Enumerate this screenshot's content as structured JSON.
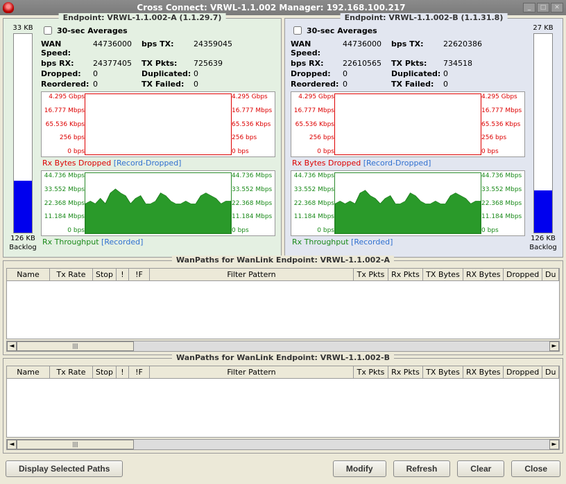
{
  "window": {
    "title": "Cross Connect: VRWL-1.1.002  Manager: 192.168.100.217"
  },
  "endpointA": {
    "title": "Endpoint: VRWL-1.1.002-A  (1.1.29.7)",
    "gauge_top": "33 KB",
    "gauge_bottom_val": "126 KB",
    "gauge_bottom_lbl": "Backlog",
    "gauge_fill_pct": 26,
    "avg_label": "30-sec Averages",
    "stats": {
      "wan_speed_lbl": "WAN Speed:",
      "wan_speed": "44736000",
      "bps_tx_lbl": "bps TX:",
      "bps_tx": "24359045",
      "bps_rx_lbl": "bps RX:",
      "bps_rx": "24377405",
      "tx_pkts_lbl": "TX Pkts:",
      "tx_pkts": "725639",
      "dropped_lbl": "Dropped:",
      "dropped": "0",
      "duplicated_lbl": "Duplicated:",
      "duplicated": "0",
      "reordered_lbl": "Reordered:",
      "reordered": "0",
      "tx_failed_lbl": "TX Failed:",
      "tx_failed": "0"
    },
    "red_chart": {
      "label_main": "Rx Bytes Dropped",
      "label_rec": "[Record-Dropped]",
      "ticks": [
        "4.295 Gbps",
        "16.777 Mbps",
        "65.536 Kbps",
        "256 bps",
        "0 bps"
      ]
    },
    "green_chart": {
      "label_main": "Rx Throughput",
      "label_rec": "[Recorded]",
      "ticks": [
        "44.736 Mbps",
        "33.552 Mbps",
        "22.368 Mbps",
        "11.184 Mbps",
        "0 bps"
      ]
    }
  },
  "endpointB": {
    "title": "Endpoint: VRWL-1.1.002-B  (1.1.31.8)",
    "gauge_top": "27 KB",
    "gauge_bottom_val": "126 KB",
    "gauge_bottom_lbl": "Backlog",
    "gauge_fill_pct": 21,
    "avg_label": "30-sec Averages",
    "stats": {
      "wan_speed_lbl": "WAN Speed:",
      "wan_speed": "44736000",
      "bps_tx_lbl": "bps TX:",
      "bps_tx": "22620386",
      "bps_rx_lbl": "bps RX:",
      "bps_rx": "22610565",
      "tx_pkts_lbl": "TX Pkts:",
      "tx_pkts": "734518",
      "dropped_lbl": "Dropped:",
      "dropped": "0",
      "duplicated_lbl": "Duplicated:",
      "duplicated": "0",
      "reordered_lbl": "Reordered:",
      "reordered": "0",
      "tx_failed_lbl": "TX Failed:",
      "tx_failed": "0"
    },
    "red_chart": {
      "label_main": "Rx Bytes Dropped",
      "label_rec": "[Record-Dropped]",
      "ticks": [
        "4.295 Gbps",
        "16.777 Mbps",
        "65.536 Kbps",
        "256 bps",
        "0 bps"
      ]
    },
    "green_chart": {
      "label_main": "Rx Throughput",
      "label_rec": "[Recorded]",
      "ticks": [
        "44.736 Mbps",
        "33.552 Mbps",
        "22.368 Mbps",
        "11.184 Mbps",
        "0 bps"
      ]
    }
  },
  "wanpaths": {
    "titleA": "WanPaths for WanLink Endpoint: VRWL-1.1.002-A",
    "titleB": "WanPaths for WanLink Endpoint: VRWL-1.1.002-B",
    "columns": [
      "Name",
      "Tx Rate",
      "Stop",
      "!",
      "!F",
      "Filter Pattern",
      "Tx Pkts",
      "Rx Pkts",
      "TX Bytes",
      "RX Bytes",
      "Dropped",
      "Du"
    ]
  },
  "buttons": {
    "display": "Display Selected Paths",
    "modify": "Modify",
    "refresh": "Refresh",
    "clear": "Clear",
    "close": "Close"
  },
  "chart_data": [
    {
      "type": "line",
      "title": "Rx Bytes Dropped (Endpoint A)",
      "ylabel": "bps",
      "ylim": [
        0,
        4295000000
      ],
      "yticks": [
        0,
        256,
        65536,
        16777000,
        4295000000
      ],
      "x": [
        0,
        1,
        2,
        3,
        4,
        5,
        6,
        7,
        8,
        9,
        10,
        11,
        12,
        13,
        14,
        15,
        16,
        17,
        18,
        19
      ],
      "values": [
        0,
        0,
        0,
        0,
        0,
        0,
        0,
        0,
        0,
        0,
        0,
        0,
        0,
        0,
        0,
        0,
        0,
        0,
        0,
        0
      ]
    },
    {
      "type": "area",
      "title": "Rx Throughput (Endpoint A)",
      "ylabel": "Mbps",
      "ylim": [
        0,
        44.736
      ],
      "yticks": [
        0,
        11.184,
        22.368,
        33.552,
        44.736
      ],
      "x": [
        0,
        1,
        2,
        3,
        4,
        5,
        6,
        7,
        8,
        9,
        10,
        11,
        12,
        13,
        14,
        15,
        16,
        17,
        18,
        19,
        20,
        21,
        22,
        23,
        24,
        25,
        26,
        27,
        28,
        29
      ],
      "values": [
        22,
        24,
        22,
        26,
        22,
        30,
        33,
        30,
        28,
        22,
        26,
        28,
        22,
        22,
        24,
        30,
        28,
        24,
        22,
        22,
        24,
        22,
        22,
        28,
        30,
        28,
        26,
        22,
        24,
        24
      ]
    },
    {
      "type": "line",
      "title": "Rx Bytes Dropped (Endpoint B)",
      "ylabel": "bps",
      "ylim": [
        0,
        4295000000
      ],
      "yticks": [
        0,
        256,
        65536,
        16777000,
        4295000000
      ],
      "x": [
        0,
        1,
        2,
        3,
        4,
        5,
        6,
        7,
        8,
        9,
        10,
        11,
        12,
        13,
        14,
        15,
        16,
        17,
        18,
        19
      ],
      "values": [
        0,
        0,
        0,
        0,
        0,
        0,
        0,
        0,
        0,
        0,
        0,
        0,
        0,
        0,
        0,
        0,
        0,
        0,
        0,
        0
      ]
    },
    {
      "type": "area",
      "title": "Rx Throughput (Endpoint B)",
      "ylabel": "Mbps",
      "ylim": [
        0,
        44.736
      ],
      "yticks": [
        0,
        11.184,
        22.368,
        33.552,
        44.736
      ],
      "x": [
        0,
        1,
        2,
        3,
        4,
        5,
        6,
        7,
        8,
        9,
        10,
        11,
        12,
        13,
        14,
        15,
        16,
        17,
        18,
        19,
        20,
        21,
        22,
        23,
        24,
        25,
        26,
        27,
        28,
        29
      ],
      "values": [
        22,
        24,
        22,
        24,
        22,
        30,
        32,
        28,
        26,
        22,
        26,
        28,
        22,
        22,
        24,
        30,
        28,
        24,
        22,
        22,
        24,
        22,
        22,
        28,
        30,
        28,
        26,
        22,
        24,
        24
      ]
    }
  ]
}
